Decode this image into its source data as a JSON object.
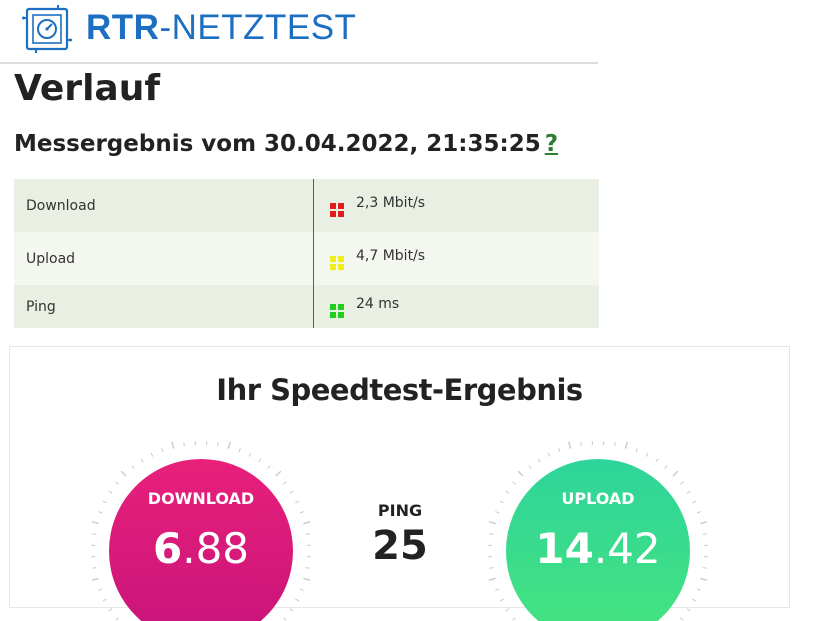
{
  "header": {
    "brand_bold": "RTR",
    "brand_rest": "-NETZTEST",
    "logo_icon": "speedometer-icon"
  },
  "page": {
    "title": "Verlauf",
    "measurement_title": "Messergebnis vom 30.04.2022, 21:35:25",
    "help_label": "?"
  },
  "results": [
    {
      "label": "Download",
      "value": "2,3 Mbit/s",
      "rating_color": "#e31b1b"
    },
    {
      "label": "Upload",
      "value": "4,7 Mbit/s",
      "rating_color": "#f2ee1a"
    },
    {
      "label": "Ping",
      "value": "24 ms",
      "rating_color": "#1fd11f"
    }
  ],
  "speedtest": {
    "title": "Ihr Speedtest-Ergebnis",
    "download": {
      "label": "DOWNLOAD",
      "int": "6",
      "dec": ".88",
      "color_top": "#e8207a",
      "color_bottom": "#c8137b"
    },
    "ping": {
      "label": "PING",
      "value": "25"
    },
    "upload": {
      "label": "UPLOAD",
      "int": "14",
      "dec": ".42",
      "color_top": "#2ed49a",
      "color_bottom": "#45e47f"
    }
  }
}
